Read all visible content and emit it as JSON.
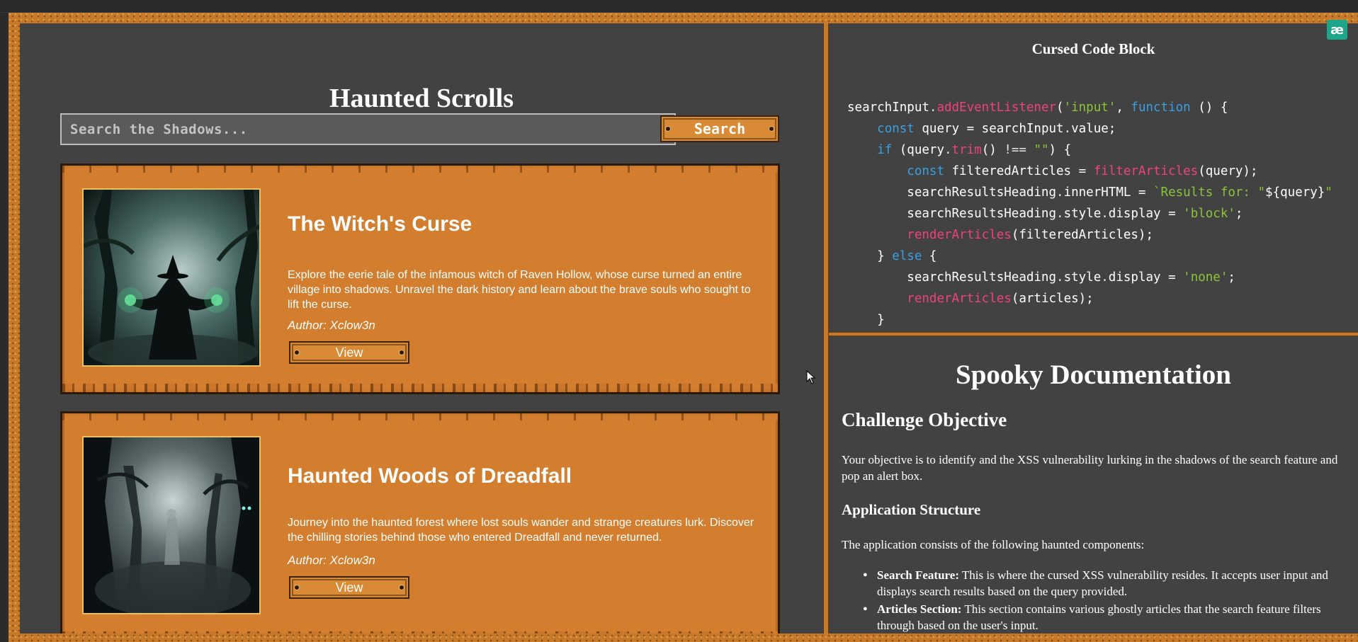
{
  "site": {
    "title": "Haunted Scrolls",
    "search_placeholder": "Search the Shadows...",
    "search_button": "Search"
  },
  "articles": [
    {
      "title": "The Witch's Curse",
      "description": "Explore the eerie tale of the infamous witch of Raven Hollow, whose curse turned an entire village into shadows. Unravel the dark history and learn about the brave souls who sought to lift the curse.",
      "author": "Author: Xclow3n",
      "view_label": "View",
      "image_icon": "witch-image"
    },
    {
      "title": "Haunted Woods of Dreadfall",
      "description": "Journey into the haunted forest where lost souls wander and strange creatures lurk. Discover the chilling stories behind those who entered Dreadfall and never returned.",
      "author": "Author: Xclow3n",
      "view_label": "View",
      "image_icon": "haunted-woods-image"
    }
  ],
  "code_panel": {
    "title": "Cursed Code Block",
    "lines": [
      [
        [
          "plain",
          "searchInput"
        ],
        [
          "op",
          "."
        ],
        [
          "fn",
          "addEventListener"
        ],
        [
          "plain",
          "("
        ],
        [
          "str",
          "'input'"
        ],
        [
          "plain",
          ", "
        ],
        [
          "kw",
          "function"
        ],
        [
          "plain",
          " () {"
        ]
      ],
      [
        [
          "plain",
          "    "
        ],
        [
          "kw",
          "const"
        ],
        [
          "plain",
          " query = searchInput"
        ],
        [
          "op",
          "."
        ],
        [
          "plain",
          "value;"
        ]
      ],
      [
        [
          "plain",
          "    "
        ],
        [
          "kw",
          "if"
        ],
        [
          "plain",
          " (query"
        ],
        [
          "op",
          "."
        ],
        [
          "fn",
          "trim"
        ],
        [
          "plain",
          "() "
        ],
        [
          "op",
          "!=="
        ],
        [
          "plain",
          " "
        ],
        [
          "str",
          "\"\""
        ],
        [
          "plain",
          ") {"
        ]
      ],
      [
        [
          "plain",
          "        "
        ],
        [
          "kw",
          "const"
        ],
        [
          "plain",
          " filteredArticles = "
        ],
        [
          "fn",
          "filterArticles"
        ],
        [
          "plain",
          "(query);"
        ]
      ],
      [
        [
          "plain",
          "        searchResultsHeading"
        ],
        [
          "op",
          "."
        ],
        [
          "plain",
          "innerHTML = "
        ],
        [
          "str",
          "`Results for: \""
        ],
        [
          "plain",
          "${query}"
        ],
        [
          "str",
          "\""
        ]
      ],
      [
        [
          "plain",
          "        searchResultsHeading"
        ],
        [
          "op",
          "."
        ],
        [
          "plain",
          "style"
        ],
        [
          "op",
          "."
        ],
        [
          "plain",
          "display = "
        ],
        [
          "str",
          "'block'"
        ],
        [
          "plain",
          ";"
        ]
      ],
      [
        [
          "plain",
          "        "
        ],
        [
          "fn",
          "renderArticles"
        ],
        [
          "plain",
          "(filteredArticles);"
        ]
      ],
      [
        [
          "plain",
          "    } "
        ],
        [
          "kw",
          "else"
        ],
        [
          "plain",
          " {"
        ]
      ],
      [
        [
          "plain",
          "        searchResultsHeading"
        ],
        [
          "op",
          "."
        ],
        [
          "plain",
          "style"
        ],
        [
          "op",
          "."
        ],
        [
          "plain",
          "display = "
        ],
        [
          "str",
          "'none'"
        ],
        [
          "plain",
          ";"
        ]
      ],
      [
        [
          "plain",
          "        "
        ],
        [
          "fn",
          "renderArticles"
        ],
        [
          "plain",
          "(articles);"
        ]
      ],
      [
        [
          "plain",
          "    }"
        ]
      ]
    ],
    "colors": {
      "fn": "#f0427a",
      "kw": "#3aa0e0",
      "str": "#8ac43a",
      "plain": "#ffffff"
    }
  },
  "docs": {
    "title": "Spooky Documentation",
    "objective_heading": "Challenge Objective",
    "objective_text": "Your objective is to identify and the XSS vulnerability lurking in the shadows of the search feature and pop an alert box.",
    "structure_heading": "Application Structure",
    "structure_intro": "The application consists of the following haunted components:",
    "items": [
      {
        "term": "Search Feature:",
        "text": " This is where the cursed XSS vulnerability resides. It accepts user input and displays search results based on the query provided."
      },
      {
        "term": "Articles Section:",
        "text": " This section contains various ghostly articles that the search feature filters through based on the user's input."
      }
    ]
  },
  "extension_icon": {
    "glyph": "æ",
    "color": "#1ea58a"
  },
  "theme": {
    "panel_bg": "#424242",
    "frame": "#c67a2a",
    "card": "#d27e2e"
  }
}
